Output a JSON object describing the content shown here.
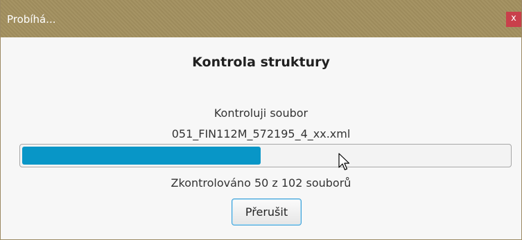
{
  "window": {
    "title": "Probíhá...",
    "close_label": "x"
  },
  "dialog": {
    "heading": "Kontrola struktury",
    "status_line": "Kontroluji soubor",
    "current_file": "051_FIN112M_572195_4_xx.xml",
    "counter_text": "Zkontrolováno 50 z 102 souborů",
    "abort_label": "Přerušit"
  },
  "progress": {
    "checked": 50,
    "total": 102,
    "fraction": 0.49
  },
  "colors": {
    "titlebar": "#a3905f",
    "close_button": "#c9404b",
    "progress_fill": "#0896c7",
    "button_focus": "#3aa0d8"
  },
  "icons": {
    "cursor": "mouse-pointer-icon"
  }
}
